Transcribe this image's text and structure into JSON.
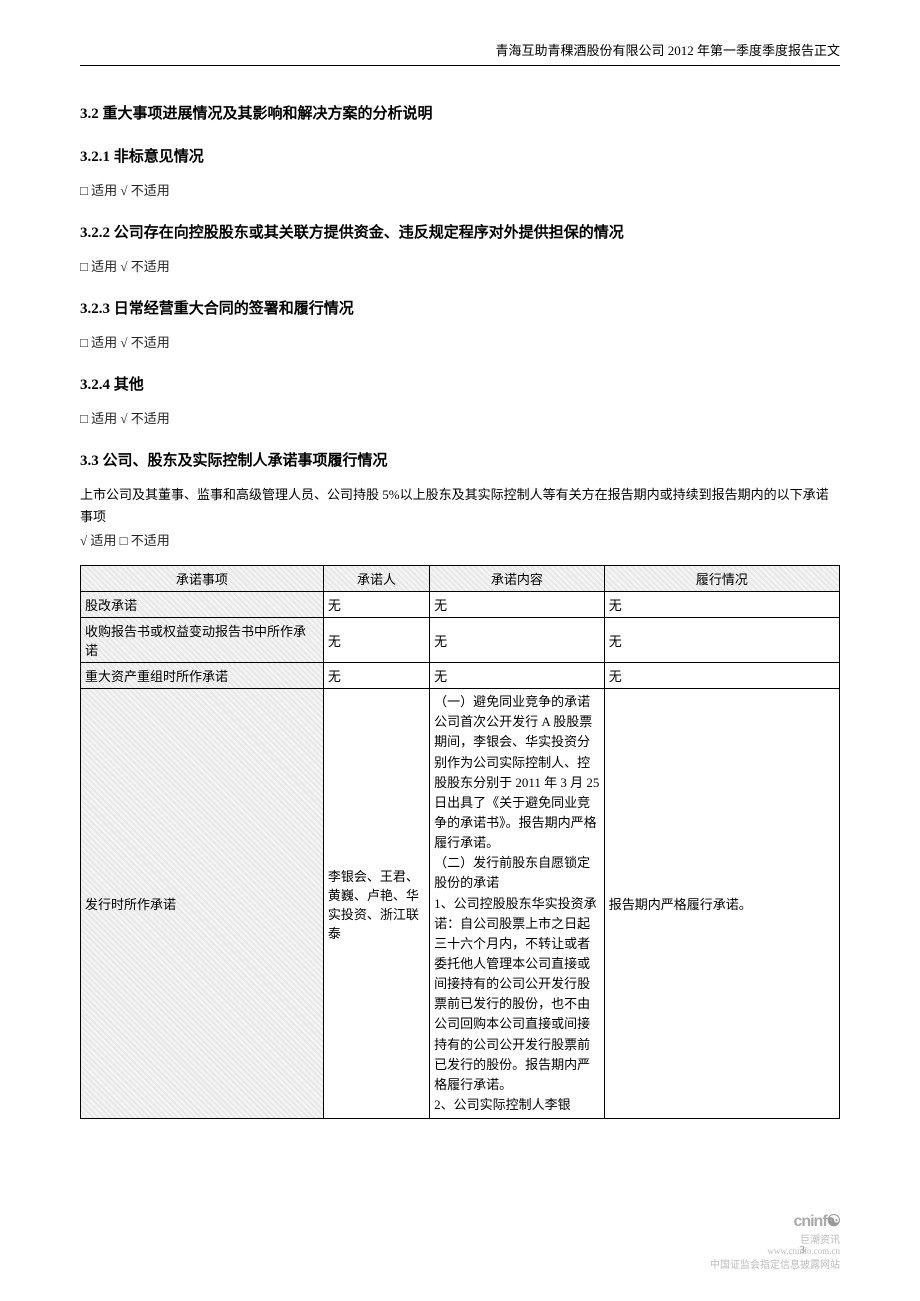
{
  "header": "青海互助青稞酒股份有限公司 2012 年第一季度季度报告正文",
  "s32": "3.2 重大事项进展情况及其影响和解决方案的分析说明",
  "s321": "3.2.1 非标意见情况",
  "s322": "3.2.2 公司存在向控股股东或其关联方提供资金、违反规定程序对外提供担保的情况",
  "s323": "3.2.3 日常经营重大合同的签署和履行情况",
  "s324": "3.2.4 其他",
  "na": "□ 适用 √ 不适用",
  "s33": "3.3 公司、股东及实际控制人承诺事项履行情况",
  "intro": "上市公司及其董事、监事和高级管理人员、公司持股 5%以上股东及其实际控制人等有关方在报告期内或持续到报告期内的以下承诺事项",
  "ya": "√ 适用 □ 不适用",
  "th": {
    "a": "承诺事项",
    "b": "承诺人",
    "c": "承诺内容",
    "d": "履行情况"
  },
  "none": "无",
  "rows": {
    "r1a": "股改承诺",
    "r2a": "收购报告书或权益变动报告书中所作承诺",
    "r3a": "重大资产重组时所作承诺",
    "r4a": "发行时所作承诺",
    "r4b": "李银会、王君、黄巍、卢艳、华实投资、浙江联泰",
    "r4c": "（一）避免同业竞争的承诺\n公司首次公开发行 A 股股票期间，李银会、华实投资分别作为公司实际控制人、控股股东分别于 2011 年 3 月 25 日出具了《关于避免同业竞争的承诺书》。报告期内严格履行承诺。\n（二）发行前股东自愿锁定股份的承诺\n1、公司控股股东华实投资承诺：自公司股票上市之日起三十六个月内，不转让或者委托他人管理本公司直接或间接持有的公司公开发行股票前已发行的股份，也不由公司回购本公司直接或间接持有的公司公开发行股票前已发行的股份。报告期内严格履行承诺。\n2、公司实际控制人李银",
    "r4d": "报告期内严格履行承诺。"
  },
  "page_num": "3",
  "logo": {
    "brand": "cninf",
    "suffix": "巨潮资讯",
    "url": "www.cninfo.com.cn",
    "line": "中国证监会指定信息披露网站"
  }
}
